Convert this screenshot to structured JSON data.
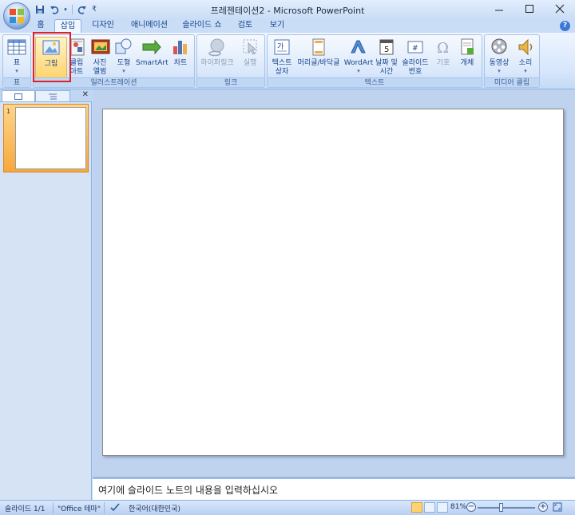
{
  "window": {
    "title": "프레젠테이션2 - Microsoft PowerPoint"
  },
  "quick_access": {
    "undo_arrow": "▾",
    "customize": "₹"
  },
  "tabs": [
    {
      "label": "홈"
    },
    {
      "label": "삽입"
    },
    {
      "label": "디자인"
    },
    {
      "label": "애니메이션"
    },
    {
      "label": "슬라이드 쇼"
    },
    {
      "label": "검토"
    },
    {
      "label": "보기"
    }
  ],
  "active_tab": "삽입",
  "ribbon": {
    "groups": {
      "table": {
        "label": "표",
        "buttons": [
          {
            "label": "표",
            "icon": "table-icon"
          }
        ]
      },
      "illustrations": {
        "label": "일러스트레이션",
        "buttons": [
          {
            "label": "그림",
            "icon": "picture-icon"
          },
          {
            "label": "클립 아트",
            "icon": "clipart-icon"
          },
          {
            "label": "사진 앨범",
            "icon": "photo-album-icon"
          },
          {
            "label": "도형",
            "icon": "shapes-icon"
          },
          {
            "label": "SmartArt",
            "icon": "smartart-icon"
          },
          {
            "label": "차트",
            "icon": "chart-icon"
          }
        ]
      },
      "links": {
        "label": "링크",
        "buttons": [
          {
            "label": "하이퍼링크",
            "icon": "hyperlink-icon"
          },
          {
            "label": "실행",
            "icon": "action-icon"
          }
        ]
      },
      "text": {
        "label": "텍스트",
        "buttons": [
          {
            "label": "텍스트 상자",
            "icon": "textbox-icon"
          },
          {
            "label": "머리글/바닥글",
            "icon": "header-footer-icon"
          },
          {
            "label": "WordArt",
            "icon": "wordart-icon"
          },
          {
            "label": "날짜 및 시간",
            "icon": "datetime-icon"
          },
          {
            "label": "슬라이드 번호",
            "icon": "slide-number-icon"
          },
          {
            "label": "기호",
            "icon": "symbol-icon"
          },
          {
            "label": "개체",
            "icon": "object-icon"
          }
        ]
      },
      "media": {
        "label": "미디어 클립",
        "buttons": [
          {
            "label": "동영상",
            "icon": "movie-icon"
          },
          {
            "label": "소리",
            "icon": "sound-icon"
          }
        ]
      }
    }
  },
  "slides_panel": {
    "slide_number": "1"
  },
  "notes": {
    "placeholder": "여기에 슬라이드 노트의 내용을 입력하십시오"
  },
  "status": {
    "slide_info": "슬라이드 1/1",
    "theme": "\"Office 테마\"",
    "language": "한국어(대한민국)",
    "zoom": "81%"
  },
  "colors": {
    "ribbon_bg": "#d6e6fb",
    "highlight": "#e0202a",
    "selected_button": "#ffd46e"
  }
}
